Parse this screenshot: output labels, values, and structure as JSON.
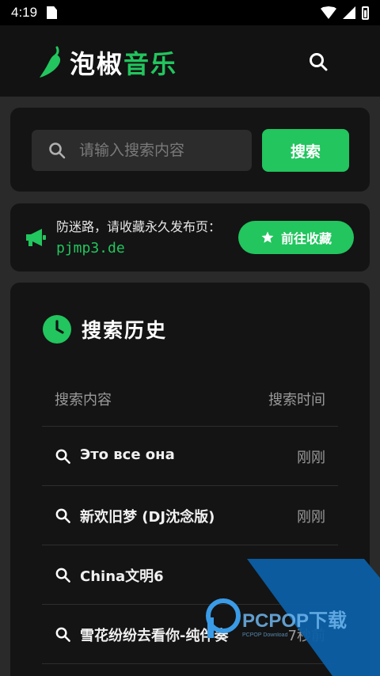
{
  "status_bar": {
    "time": "4:19"
  },
  "header": {
    "logo_white": "泡椒",
    "logo_green": "音乐",
    "search_icon": "search-icon"
  },
  "search": {
    "placeholder": "请输入搜索内容",
    "button_label": "搜索"
  },
  "notice": {
    "text": "防迷路，请收藏永久发布页：",
    "url": "pjmp3.de",
    "button_label": "前往收藏"
  },
  "history": {
    "title": "搜索历史",
    "col_content": "搜索内容",
    "col_time": "搜索时间",
    "items": [
      {
        "query": "Это все она",
        "time": "刚刚"
      },
      {
        "query": "新欢旧梦 (DJ沈念版)",
        "time": "刚刚"
      },
      {
        "query": "China文明6",
        "time": ""
      },
      {
        "query": "雪花纷纷去看你-纯伴奏",
        "time": "7秒前"
      }
    ]
  },
  "watermark": {
    "text": "PCPOP下载",
    "sub": "PCPOP Download"
  },
  "colors": {
    "accent": "#22c55e",
    "background": "#2a2a2a",
    "card": "#141414",
    "header": "#121212"
  }
}
